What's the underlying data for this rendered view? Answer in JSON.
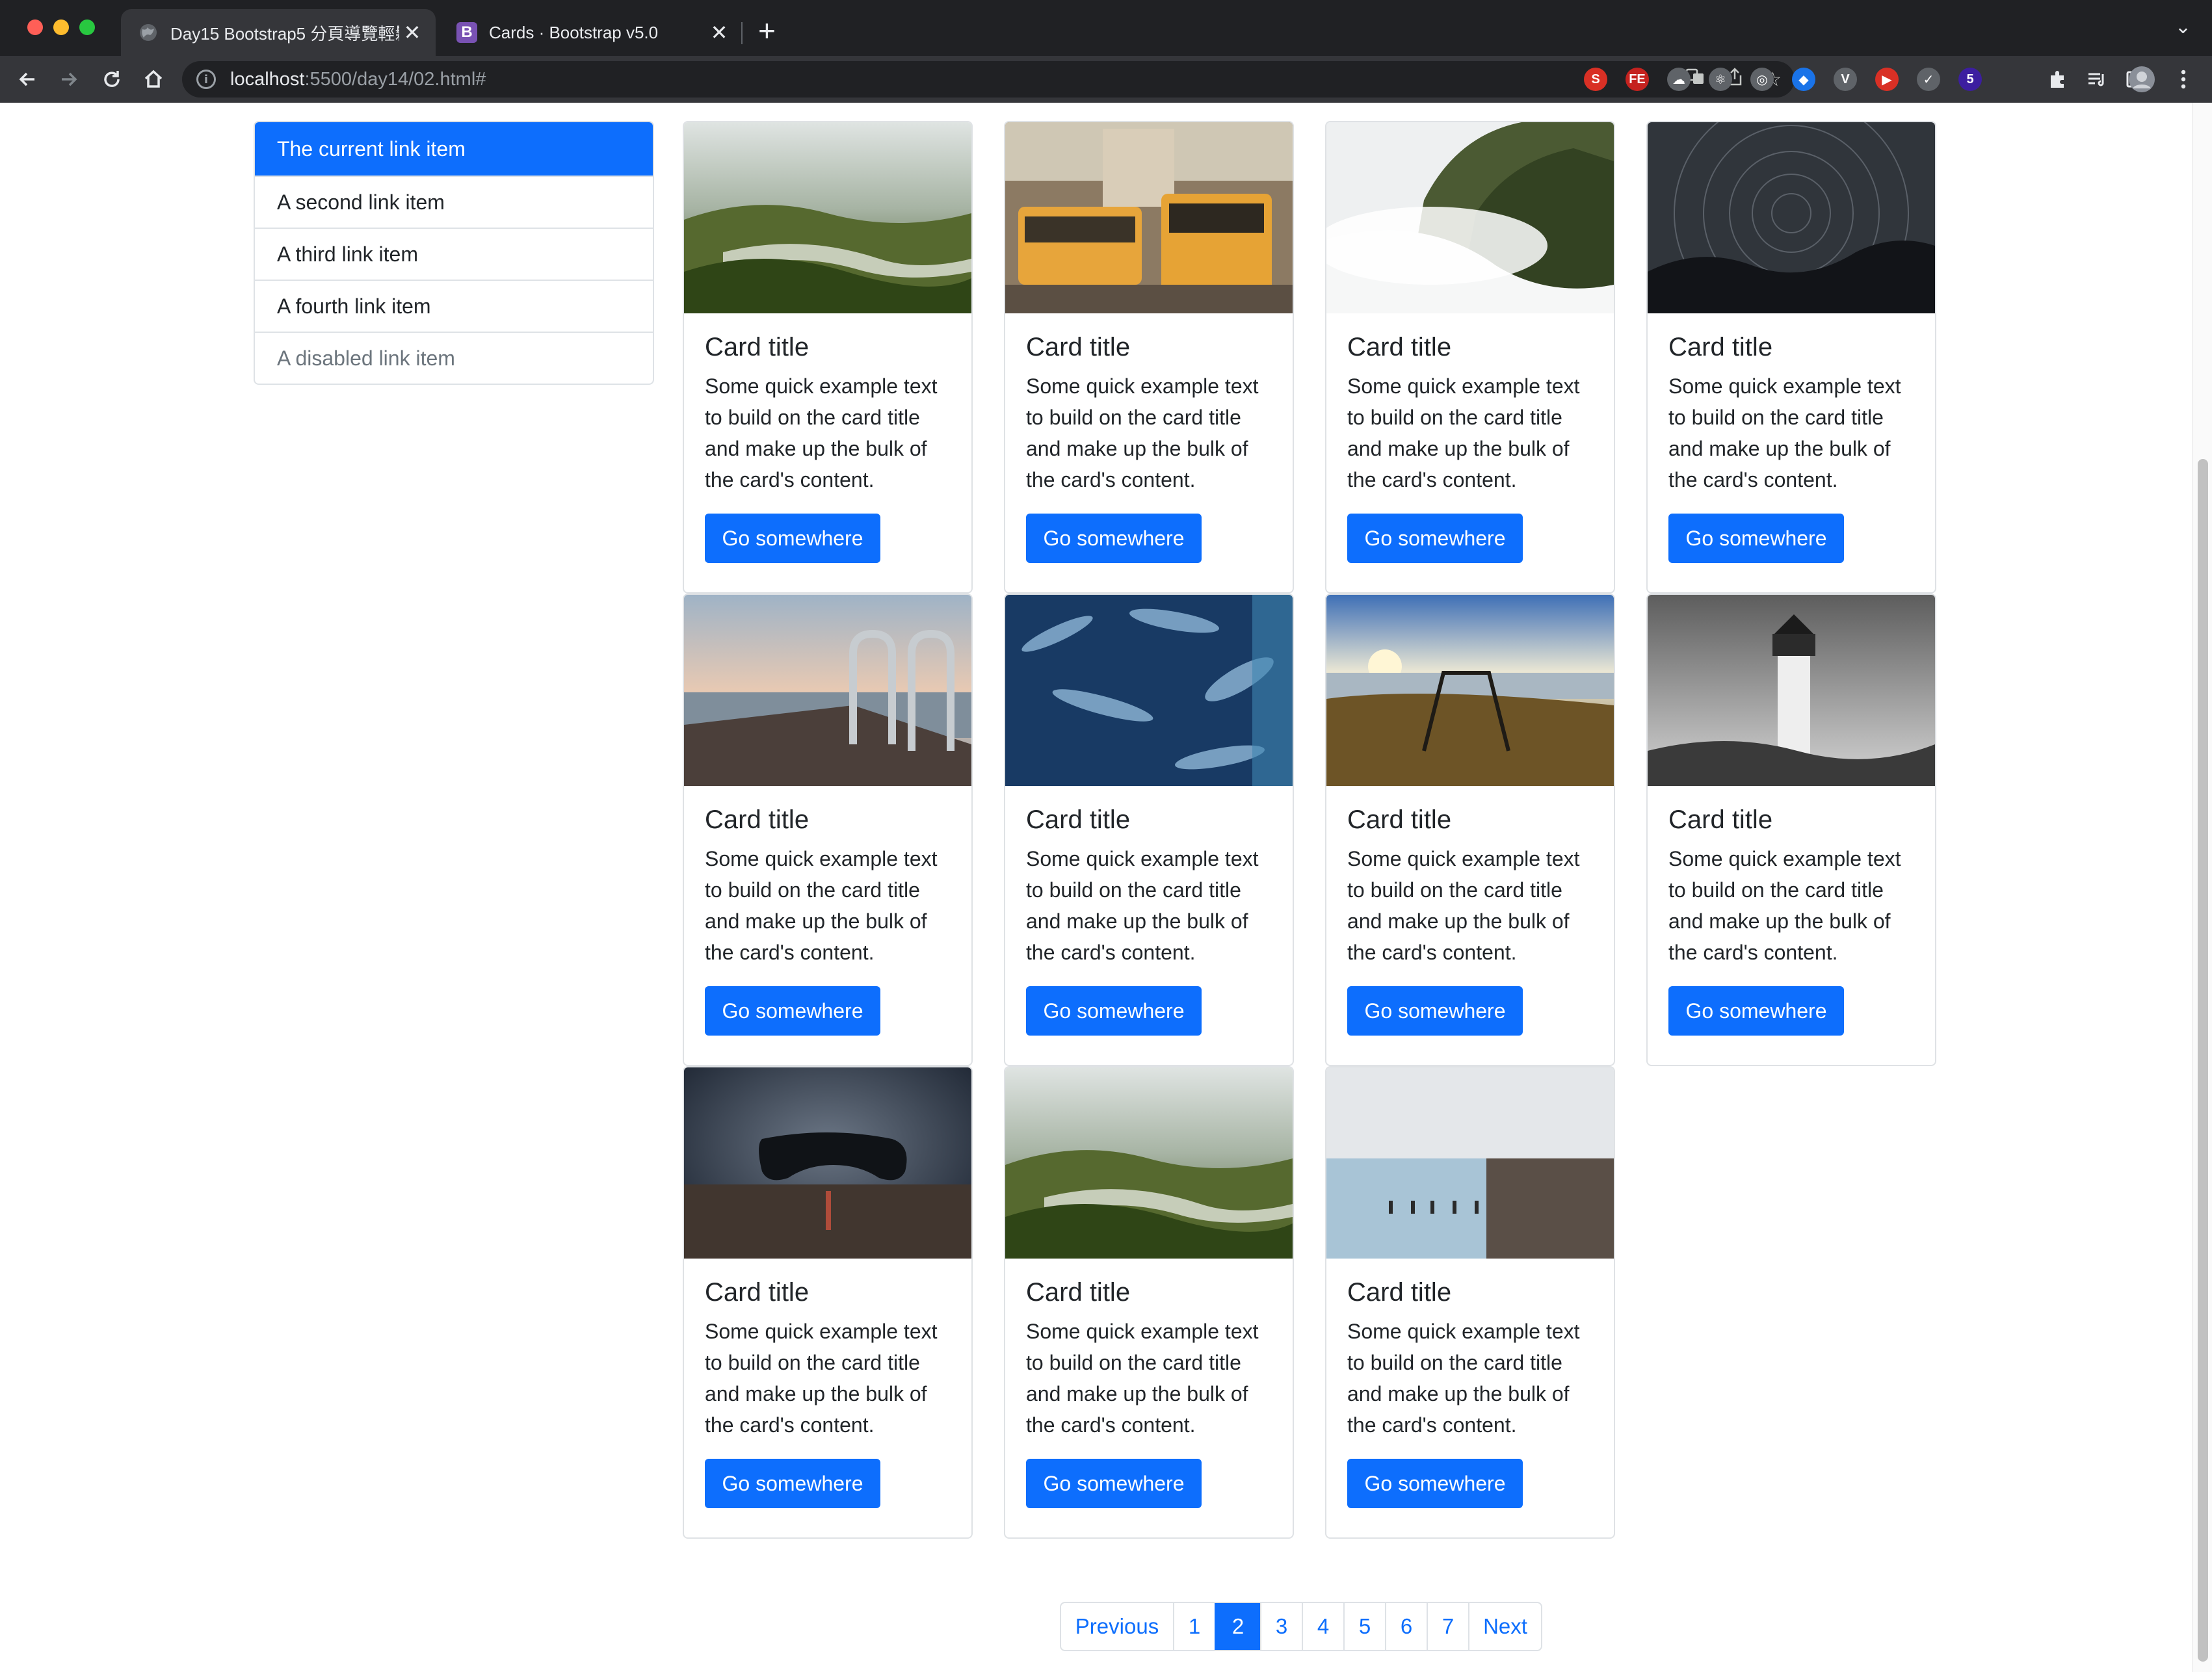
{
  "browser": {
    "tabs": [
      {
        "title": "Day15 Bootstrap5 分頁導覽輕鬆",
        "favicon": "globe-icon",
        "active": true
      },
      {
        "title": "Cards · Bootstrap v5.0",
        "favicon": "bootstrap-icon",
        "favicon_text": "B",
        "active": false
      }
    ],
    "close_glyph": "✕",
    "new_tab_glyph": "+",
    "url_host": "localhost",
    "url_path": ":5500/day14/02.html#",
    "extensions": [
      {
        "name": "s-extension-icon",
        "label": "S",
        "color": "#d93025"
      },
      {
        "name": "fe-extension-icon",
        "label": "FE",
        "color": "#c5221f"
      },
      {
        "name": "cloud-extension-icon",
        "label": "☁",
        "color": "#5f6368"
      },
      {
        "name": "react-devtools-icon",
        "label": "⚛",
        "color": "#5f6368"
      },
      {
        "name": "target-extension-icon",
        "label": "◎",
        "color": "#5f6368"
      },
      {
        "name": "gem-extension-icon",
        "label": "◆",
        "color": "#1a73e8"
      },
      {
        "name": "vue-devtools-icon",
        "label": "V",
        "color": "#5f6368"
      },
      {
        "name": "youtube-extension-icon",
        "label": "▶",
        "color": "#d93025"
      },
      {
        "name": "check-extension-icon",
        "label": "✓",
        "color": "#5f6368"
      },
      {
        "name": "badge-extension-icon",
        "label": "5",
        "color": "#3c1ea0"
      },
      {
        "name": "puzzle-extensions-icon",
        "label": "✚",
        "color": "#5f6368"
      }
    ]
  },
  "sidebar": {
    "items": [
      {
        "label": "The current link item",
        "state": "active"
      },
      {
        "label": "A second link item",
        "state": "normal"
      },
      {
        "label": "A third link item",
        "state": "normal"
      },
      {
        "label": "A fourth link item",
        "state": "normal"
      },
      {
        "label": "A disabled link item",
        "state": "disabled"
      }
    ]
  },
  "cards": [
    {
      "title": "Card title",
      "text": "Some quick example text to build on the card title and make up the bulk of the card's content.",
      "button": "Go somewhere",
      "image": "forest-river-photo"
    },
    {
      "title": "Card title",
      "text": "Some quick example text to build on the card title and make up the bulk of the card's content.",
      "button": "Go somewhere",
      "image": "tram-street-photo"
    },
    {
      "title": "Card title",
      "text": "Some quick example text to build on the card title and make up the bulk of the card's content.",
      "button": "Go somewhere",
      "image": "misty-cliff-photo"
    },
    {
      "title": "Card title",
      "text": "Some quick example text to build on the card title and make up the bulk of the card's content.",
      "button": "Go somewhere",
      "image": "star-trails-photo"
    },
    {
      "title": "Card title",
      "text": "Some quick example text to build on the card title and make up the bulk of the card's content.",
      "button": "Go somewhere",
      "image": "pier-ladder-photo"
    },
    {
      "title": "Card title",
      "text": "Some quick example text to build on the card title and make up the bulk of the card's content.",
      "button": "Go somewhere",
      "image": "water-surface-photo"
    },
    {
      "title": "Card title",
      "text": "Some quick example text to build on the card title and make up the bulk of the card's content.",
      "button": "Go somewhere",
      "image": "lakeside-swing-photo"
    },
    {
      "title": "Card title",
      "text": "Some quick example text to build on the card title and make up the bulk of the card's content.",
      "button": "Go somewhere",
      "image": "lighthouse-photo"
    },
    {
      "title": "Card title",
      "text": "Some quick example text to build on the card title and make up the bulk of the card's content.",
      "button": "Go somewhere",
      "image": "game-controller-photo"
    },
    {
      "title": "Card title",
      "text": "Some quick example text to build on the card title and make up the bulk of the card's content.",
      "button": "Go somewhere",
      "image": "forest-river-photo"
    },
    {
      "title": "Card title",
      "text": "Some quick example text to build on the card title and make up the bulk of the card's content.",
      "button": "Go somewhere",
      "image": "seaside-wall-photo"
    }
  ],
  "pagination": {
    "previous": "Previous",
    "pages": [
      "1",
      "2",
      "3",
      "4",
      "5",
      "6",
      "7"
    ],
    "active": "2",
    "next": "Next"
  },
  "colors": {
    "primary": "#0d6efd",
    "border": "#dee2e6",
    "disabled_text": "#6c757d"
  }
}
